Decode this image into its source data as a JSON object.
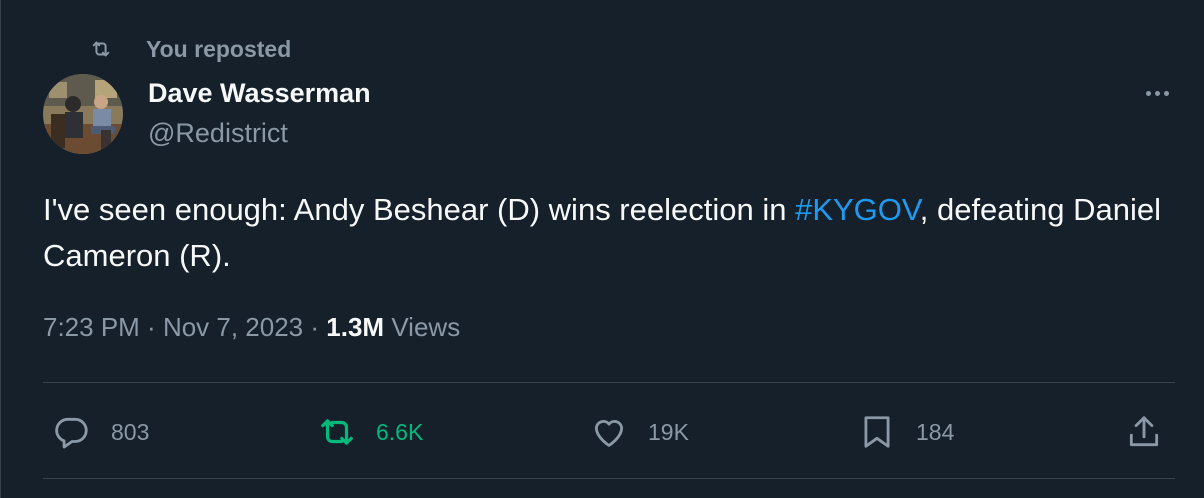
{
  "repost_label": "You reposted",
  "author": {
    "name": "Dave Wasserman",
    "handle": "@Redistrict"
  },
  "tweet": {
    "text_before": "I've seen enough: Andy Beshear (D) wins reelection in ",
    "hashtag": "#KYGOV",
    "text_after": ", defeating Daniel Cameron (R)."
  },
  "meta": {
    "time": "7:23 PM",
    "separator": " · ",
    "date": "Nov 7, 2023",
    "views_count": "1.3M",
    "views_label": "Views"
  },
  "actions": {
    "replies": "803",
    "reposts": "6.6K",
    "likes": "19K",
    "bookmarks": "184"
  },
  "colors": {
    "background": "#15202b",
    "text": "#f7f9f9",
    "secondary": "#8b98a5",
    "link": "#1d9bf0",
    "repost_active": "#00ba7c",
    "border": "#38444d"
  },
  "icons": {
    "repost_header": "repost-icon",
    "more": "more-icon",
    "reply": "reply-icon",
    "repost": "repost-icon",
    "like": "heart-icon",
    "bookmark": "bookmark-icon",
    "share": "share-icon"
  }
}
